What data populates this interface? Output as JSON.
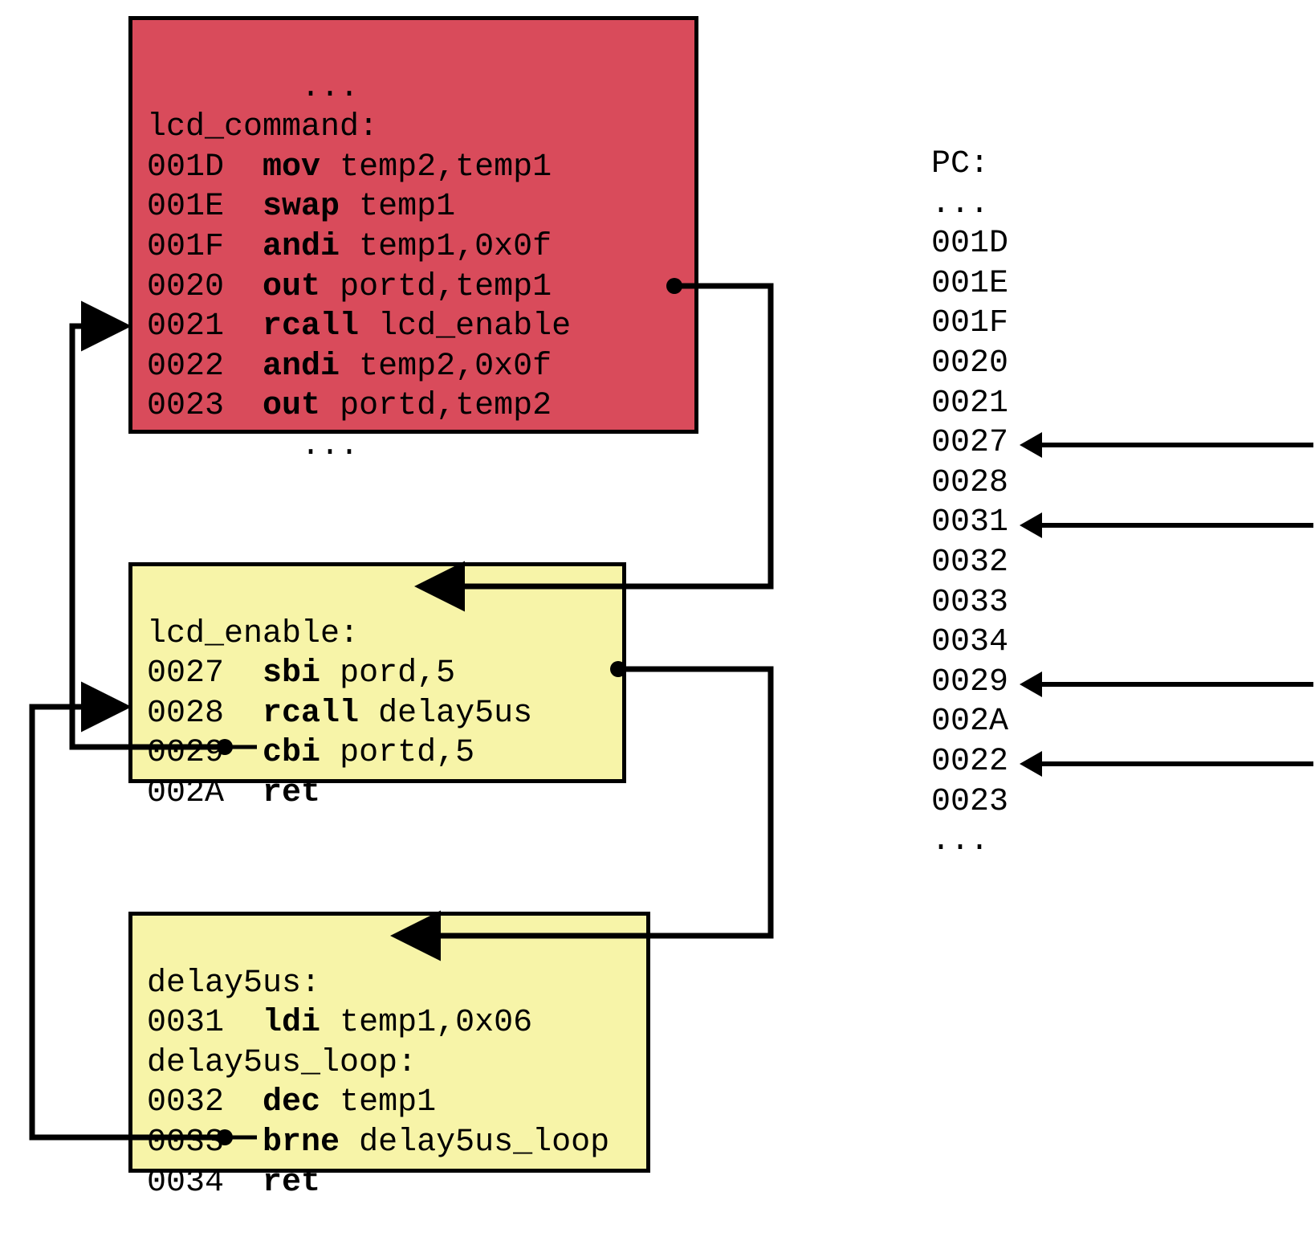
{
  "boxes": {
    "lcd_command": {
      "label": "lcd_command:",
      "pre": "        ...",
      "post": "        ...",
      "lines": [
        {
          "addr": "001D",
          "op": "mov",
          "args": "temp2,temp1"
        },
        {
          "addr": "001E",
          "op": "swap",
          "args": "temp1"
        },
        {
          "addr": "001F",
          "op": "andi",
          "args": "temp1,0x0f"
        },
        {
          "addr": "0020",
          "op": "out",
          "args": "portd,temp1"
        },
        {
          "addr": "0021",
          "op": "rcall",
          "args": "lcd_enable"
        },
        {
          "addr": "0022",
          "op": "andi",
          "args": "temp2,0x0f"
        },
        {
          "addr": "0023",
          "op": "out",
          "args": "portd,temp2"
        }
      ]
    },
    "lcd_enable": {
      "label": "lcd_enable:",
      "lines": [
        {
          "addr": "0027",
          "op": "sbi",
          "args": "pord,5"
        },
        {
          "addr": "0028",
          "op": "rcall",
          "args": "delay5us"
        },
        {
          "addr": "0029",
          "op": "cbi",
          "args": "portd,5"
        },
        {
          "addr": "002A",
          "op": "ret",
          "args": ""
        }
      ]
    },
    "delay5us": {
      "label": "delay5us:",
      "label2": "delay5us_loop:",
      "lines": [
        {
          "addr": "0031",
          "op": "ldi",
          "args": "temp1,0x06"
        },
        {
          "addr": "0032",
          "op": "dec",
          "args": "temp1"
        },
        {
          "addr": "0033",
          "op": "brne",
          "args": "delay5us_loop"
        },
        {
          "addr": "0034",
          "op": "ret",
          "args": ""
        }
      ]
    }
  },
  "pc": {
    "header": "PC:",
    "values": [
      "...",
      "001D",
      "001E",
      "001F",
      "0020",
      "0021",
      "0027",
      "0028",
      "0031",
      "0032",
      "0033",
      "0034",
      "0029",
      "002A",
      "0022",
      "0023",
      "..."
    ],
    "arrows_at": [
      "0027",
      "0031",
      "0029",
      "0022"
    ]
  },
  "colors": {
    "box_red": "#d94b5b",
    "box_yellow": "#f7f4a8"
  }
}
